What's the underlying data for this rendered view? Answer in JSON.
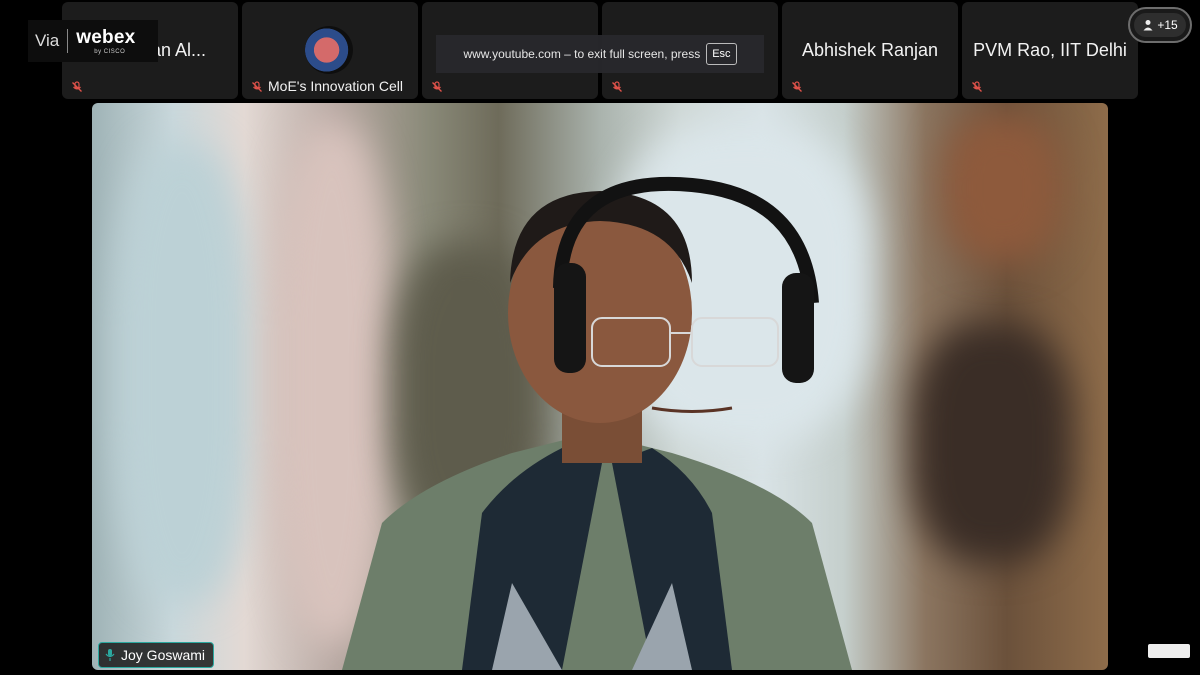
{
  "brand": {
    "via": "Via",
    "name": "webex",
    "by": "by CISCO"
  },
  "tiles": [
    {
      "label": "van Al...",
      "muted": true
    },
    {
      "label": "MoE's Innovation Cell",
      "muted": true
    },
    {
      "label": "",
      "muted": true
    },
    {
      "label": "",
      "muted": true
    },
    {
      "label": "Abhishek Ranjan",
      "muted": true
    },
    {
      "label": "PVM Rao, IIT Delhi",
      "muted": true
    }
  ],
  "fullscreen_notice": {
    "text": "www.youtube.com – to exit full screen, press",
    "key": "Esc"
  },
  "participants": {
    "count": "+15"
  },
  "main": {
    "speaker_name": "Joy Goswami"
  },
  "icons": {
    "mute": "mic-muted-icon",
    "speaking": "mic-active-icon",
    "people": "person-icon"
  },
  "colors": {
    "mute": "#e0524a",
    "speaking_outline": "#2ba9a0"
  }
}
